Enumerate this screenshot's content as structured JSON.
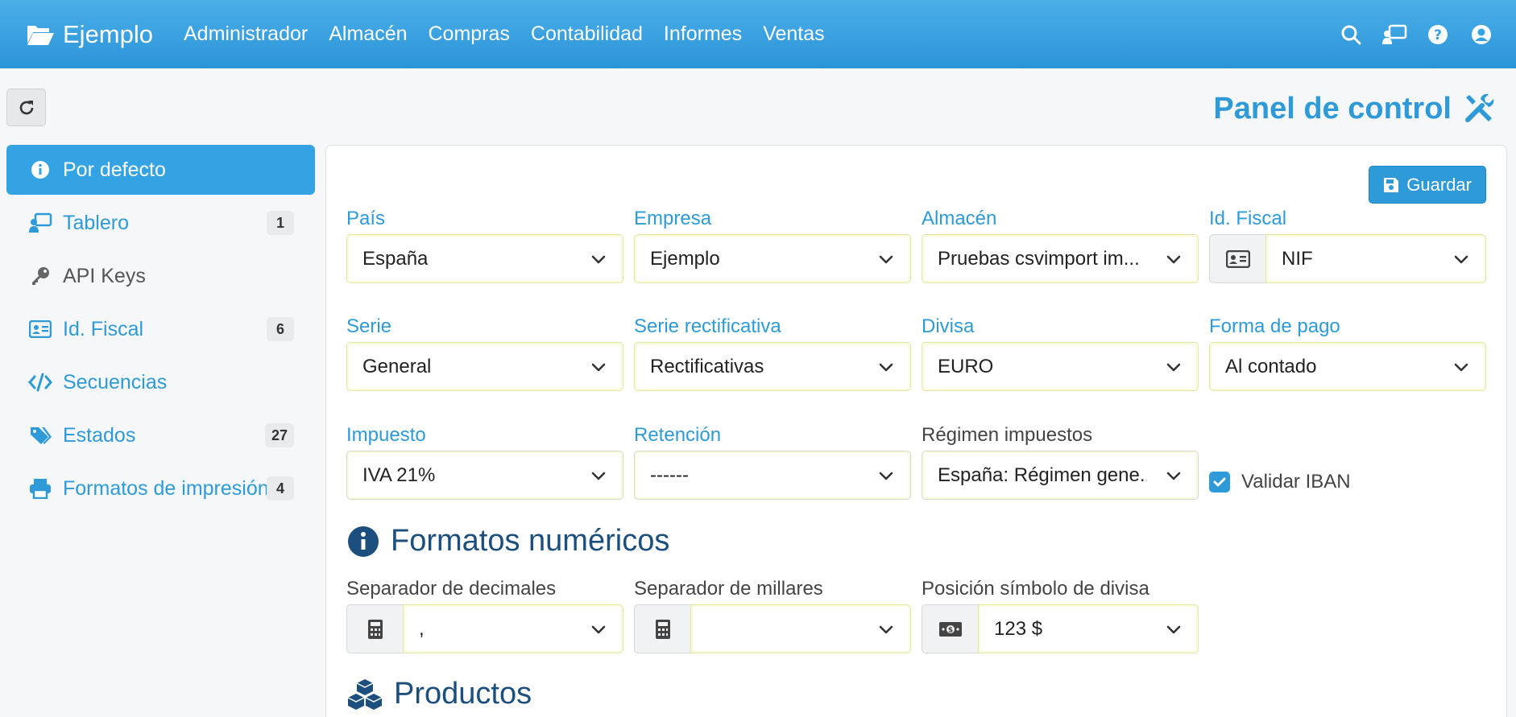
{
  "app": {
    "brand": "Ejemplo"
  },
  "menu": [
    "Administrador",
    "Almacén",
    "Compras",
    "Contabilidad",
    "Informes",
    "Ventas"
  ],
  "page": {
    "title": "Panel de control"
  },
  "sidebar": {
    "items": [
      {
        "label": "Por defecto",
        "icon": "info-circle-icon",
        "badge": ""
      },
      {
        "label": "Tablero",
        "icon": "chalkboard-user-icon",
        "badge": "1"
      },
      {
        "label": "API Keys",
        "icon": "key-icon",
        "badge": ""
      },
      {
        "label": "Id. Fiscal",
        "icon": "id-card-icon",
        "badge": "6"
      },
      {
        "label": "Secuencias",
        "icon": "code-icon",
        "badge": ""
      },
      {
        "label": "Estados",
        "icon": "tags-icon",
        "badge": "27"
      },
      {
        "label": "Formatos de impresión",
        "icon": "print-icon",
        "badge": "4"
      }
    ]
  },
  "form": {
    "save_label": "Guardar",
    "fields": {
      "pais": {
        "label": "País",
        "value": "España"
      },
      "empresa": {
        "label": "Empresa",
        "value": "Ejemplo"
      },
      "almacen": {
        "label": "Almacén",
        "value": "Pruebas csvimport im..."
      },
      "idfiscal": {
        "label": "Id. Fiscal",
        "value": "NIF"
      },
      "serie": {
        "label": "Serie",
        "value": "General"
      },
      "serie_rect": {
        "label": "Serie rectificativa",
        "value": "Rectificativas"
      },
      "divisa": {
        "label": "Divisa",
        "value": "EURO"
      },
      "forma_pago": {
        "label": "Forma de pago",
        "value": "Al contado"
      },
      "impuesto": {
        "label": "Impuesto",
        "value": "IVA 21%"
      },
      "retencion": {
        "label": "Retención",
        "value": "------"
      },
      "regimen": {
        "label": "Régimen impuestos",
        "value": "España: Régimen gene..."
      }
    },
    "validar_iban": {
      "label": "Validar IBAN",
      "checked": true
    },
    "sections": {
      "numericos": "Formatos numéricos",
      "productos": "Productos"
    },
    "numeric": {
      "decimales": {
        "label": "Separador de decimales",
        "value": ","
      },
      "millares": {
        "label": "Separador de millares",
        "value": ""
      },
      "posicion": {
        "label": "Posición símbolo de divisa",
        "value": "123 $"
      }
    }
  },
  "colors": {
    "primary": "#2e9ad8",
    "navbar": "#34a3e4",
    "heading": "#1c4f7e"
  }
}
